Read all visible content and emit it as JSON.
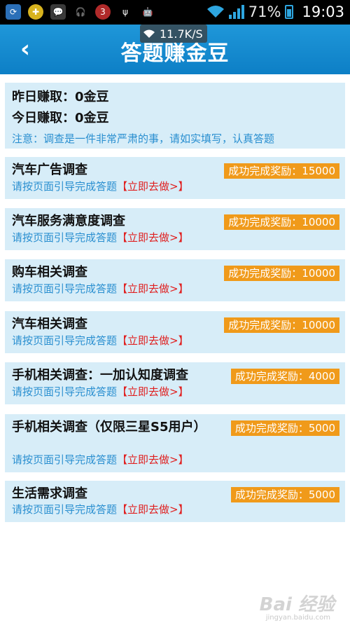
{
  "status_bar": {
    "notification_icons": [
      "sync-icon",
      "game-icon",
      "wechat-icon",
      "headset-icon",
      "badge-icon",
      "usb-icon",
      "android-icon"
    ],
    "badge_count": "3",
    "battery_percent": "71%",
    "time": "19:03",
    "network_speed": "11.7K/S"
  },
  "header": {
    "back_label": "‹",
    "title": "答题赚金豆"
  },
  "summary": {
    "yesterday": "昨日赚取：0金豆",
    "today": "今日赚取：0金豆",
    "note": "注意：调查是一件非常严肃的事，请如实填写，认真答题"
  },
  "surveys": [
    {
      "title": "汽车广告调查",
      "reward": "成功完成奖励：15000",
      "guide": "请按页面引导完成答题",
      "action": "【立即去做>】"
    },
    {
      "title": "汽车服务满意度调查",
      "reward": "成功完成奖励：10000",
      "guide": "请按页面引导完成答题",
      "action": "【立即去做>】"
    },
    {
      "title": "购车相关调查",
      "reward": "成功完成奖励：10000",
      "guide": "请按页面引导完成答题",
      "action": "【立即去做>】"
    },
    {
      "title": "汽车相关调查",
      "reward": "成功完成奖励：10000",
      "guide": "请按页面引导完成答题",
      "action": "【立即去做>】"
    },
    {
      "title": "手机相关调查：一加认知度调查",
      "reward": "成功完成奖励：4000",
      "guide": "请按页面引导完成答题",
      "action": "【立即去做>】"
    },
    {
      "title": "手机相关调查（仅限三星S5用户）",
      "reward": "成功完成奖励：5000",
      "guide": "请按页面引导完成答题",
      "action": "【立即去做>】"
    },
    {
      "title": "生活需求调查",
      "reward": "成功完成奖励：5000",
      "guide": "请按页面引导完成答题",
      "action": "【立即去做>】"
    }
  ],
  "watermark": {
    "text": "Bai 经验",
    "sub": "jingyan.baidu.com"
  },
  "colors": {
    "header": "#1f97d9",
    "card_bg": "#d7edf8",
    "reward_bg": "#f09a1a",
    "guide_text": "#2a8fd0",
    "action_link": "#e02020"
  }
}
